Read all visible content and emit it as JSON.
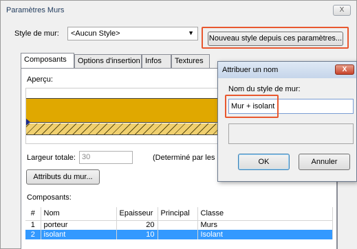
{
  "main_dialog": {
    "title": "Paramètres Murs",
    "close_label": "X",
    "style_label": "Style de mur:",
    "style_value": "<Aucun Style>",
    "new_style_button": "Nouveau style depuis ces paramètres...",
    "tabs": [
      {
        "label": "Composants"
      },
      {
        "label": "Options d'insertion"
      },
      {
        "label": "Infos"
      },
      {
        "label": "Textures"
      }
    ],
    "apercu_label": "Aperçu:",
    "largeur_label": "Largeur totale:",
    "largeur_value": "30",
    "determine_text": "(Determiné par les c",
    "attributs_button": "Attributs du mur...",
    "composants_label": "Composants:",
    "table": {
      "headers": [
        "#",
        "Nom",
        "Epaisseur",
        "Principal",
        "Classe"
      ],
      "rows": [
        {
          "num": "1",
          "nom": "porteur",
          "epaisseur": "20",
          "principal": "",
          "classe": "Murs",
          "selected": false
        },
        {
          "num": "2",
          "nom": "isolant",
          "epaisseur": "10",
          "principal": "",
          "classe": "Isolant",
          "selected": true
        }
      ]
    }
  },
  "name_dialog": {
    "title": "Attribuer un nom",
    "close_label": "X",
    "field_label": "Nom du style de mur:",
    "field_value": "Mur + isolant",
    "ok_button": "OK",
    "cancel_button": "Annuler"
  },
  "colors": {
    "highlight": "#e8572e",
    "porteur_fill": "#e0a800",
    "selection": "#3399ff"
  }
}
